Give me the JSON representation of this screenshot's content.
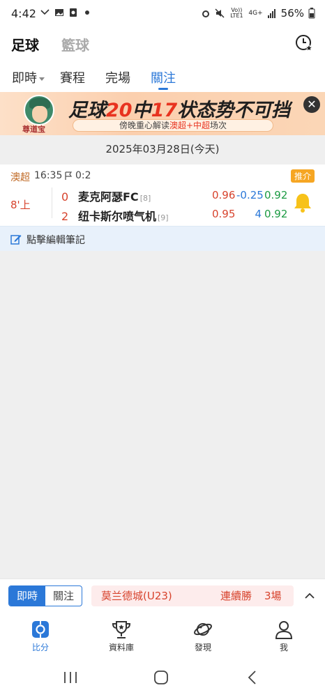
{
  "status_bar": {
    "time": "4:42",
    "battery": "56%",
    "network": "4G+",
    "volte": "Vo)) LTE1"
  },
  "top_nav": {
    "football": "足球",
    "basketball": "籃球"
  },
  "sub_tabs": [
    {
      "label": "即時",
      "active": false,
      "has_dropdown": true
    },
    {
      "label": "賽程",
      "active": false
    },
    {
      "label": "完場",
      "active": false
    },
    {
      "label": "關注",
      "active": true
    }
  ],
  "banner": {
    "avatar_name": "尊道宝",
    "headline_pre": "足球",
    "headline_num1": "20",
    "headline_mid": "中",
    "headline_num2": "17",
    "headline_post": "状态势不可挡",
    "sub_pre": "傍晚重心解读",
    "sub_highlight": "澳超+中超",
    "sub_post": "场次"
  },
  "date_label": "2025年03月28日(今天)",
  "match": {
    "league": "澳超",
    "kickoff": "16:35",
    "corner_score": "0:2",
    "tag": "推介",
    "status": "8'上",
    "home": {
      "score": "0",
      "name": "麦克阿瑟FC",
      "rank": "[8]"
    },
    "away": {
      "score": "2",
      "name": "纽卡斯尔喷气机",
      "rank": "[9]"
    },
    "odds_row1": {
      "home": "0.96",
      "handicap": "-0.25",
      "away": "0.92"
    },
    "odds_row2": {
      "home": "0.95",
      "handicap": "4",
      "away": "0.92"
    }
  },
  "note": {
    "label": "點擊編輯筆記"
  },
  "bottom_bar": {
    "seg_live": "即時",
    "seg_follow": "關注",
    "ticker_team": "莫兰德城(U23)",
    "ticker_stat": "連續勝",
    "ticker_count": "3場"
  },
  "tab_bar": [
    {
      "label": "比分",
      "icon": "score-icon",
      "active": true
    },
    {
      "label": "資料庫",
      "icon": "trophy-icon",
      "active": false
    },
    {
      "label": "發現",
      "icon": "planet-icon",
      "active": false
    },
    {
      "label": "我",
      "icon": "user-icon",
      "active": false
    }
  ],
  "colors": {
    "accent": "#2b78d8",
    "live_red": "#d7432d",
    "league_orange": "#c06a26",
    "bell_yellow": "#f7c21a",
    "odds_green": "#1c9b43"
  }
}
